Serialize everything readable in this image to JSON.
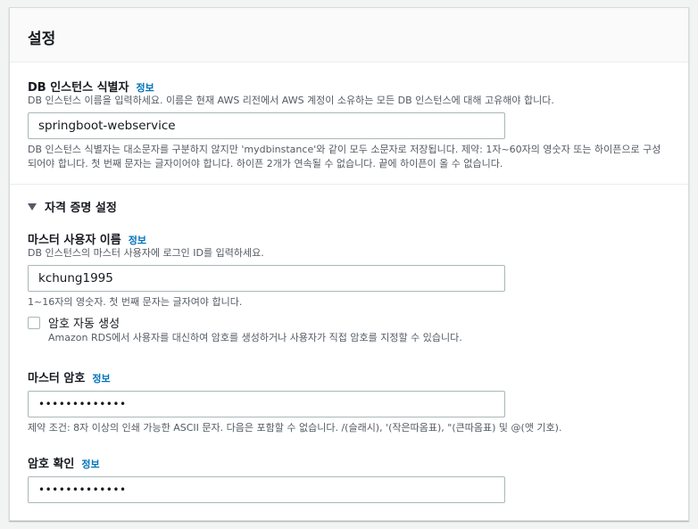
{
  "panel": {
    "title": "설정"
  },
  "info_label": "정보",
  "instance_identifier": {
    "label": "DB 인스턴스 식별자",
    "description": "DB 인스턴스 이름을 입력하세요. 이름은 현재 AWS 리전에서 AWS 계정이 소유하는 모든 DB 인스턴스에 대해 고유해야 합니다.",
    "value": "springboot-webservice",
    "constraint_line1": "DB 인스턴스 식별자는 대소문자를 구분하지 않지만 'mydbinstance'와 같이 모두 소문자로 저장됩니다. 제약: 1자~60자의 영숫자 또는 하이픈으로 구성",
    "constraint_line2": "되어야 합니다. 첫 번째 문자는 글자이어야 합니다. 하이픈 2개가 연속될 수 없습니다. 끝에 하이픈이 올 수 없습니다."
  },
  "credentials": {
    "section_title": "자격 증명 설정",
    "master_username": {
      "label": "마스터 사용자 이름",
      "description": "DB 인스턴스의 마스터 사용자에 로그인 ID를 입력하세요.",
      "value": "kchung1995",
      "constraint": "1~16자의 영숫자. 첫 번째 문자는 글자여야 합니다."
    },
    "auto_generate": {
      "label": "암호 자동 생성",
      "description": "Amazon RDS에서 사용자를 대신하여 암호를 생성하거나 사용자가 직접 암호를 지정할 수 있습니다.",
      "checked": false
    },
    "master_password": {
      "label": "마스터 암호",
      "value": "•••••••••••••",
      "constraint": "제약 조건: 8자 이상의 인쇄 가능한 ASCII 문자. 다음은 포함할 수 없습니다. /(슬래시), '(작은따옴표), \"(큰따옴표) 및 @(앳 기호)."
    },
    "confirm_password": {
      "label": "암호 확인",
      "value": "•••••••••••••"
    }
  }
}
